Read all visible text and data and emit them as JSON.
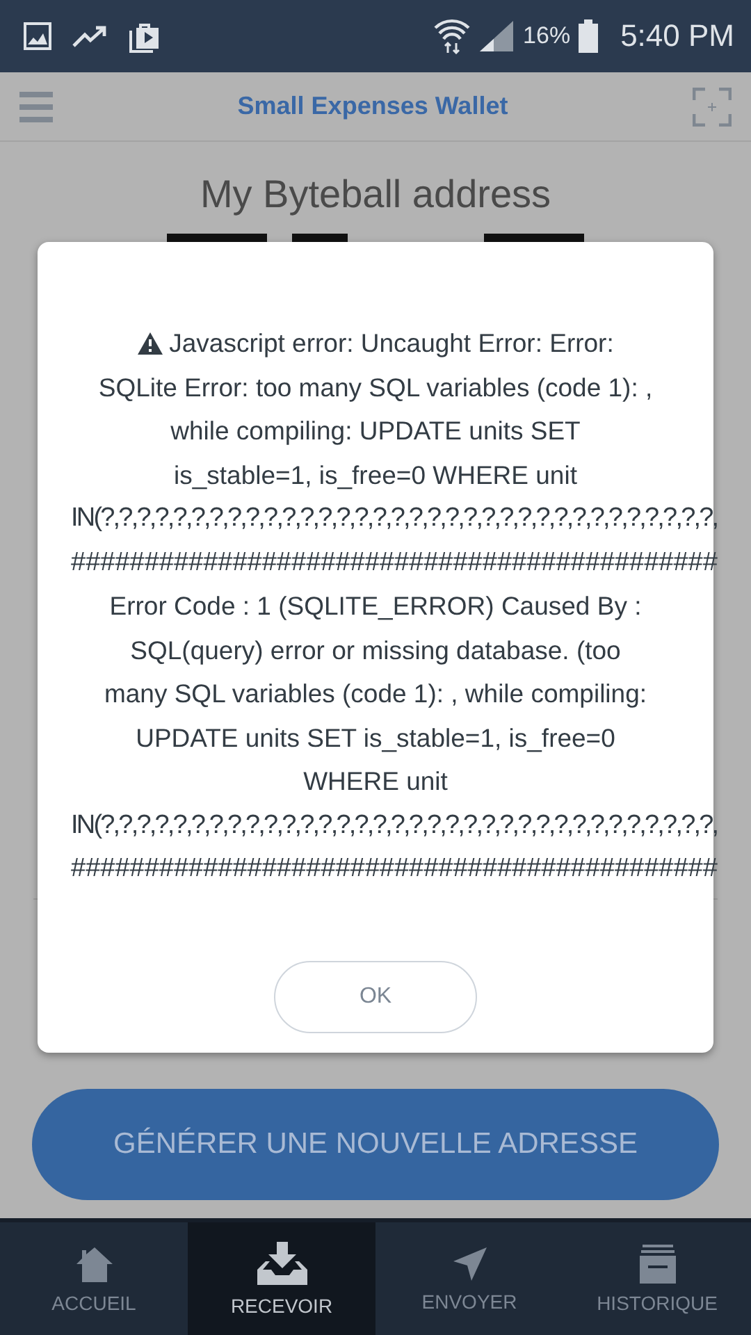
{
  "status_bar": {
    "battery": "16%",
    "time": "5:40 PM"
  },
  "header": {
    "title": "Small Expenses Wallet"
  },
  "content": {
    "heading": "My Byteball address",
    "generate_button": "GÉNÉRER UNE NOUVELLE ADRESSE"
  },
  "dialog": {
    "lines": [
      {
        "kind": "warning",
        "text": "Javascript error: Uncaught Error: Error:"
      },
      {
        "kind": "centered",
        "text": "SQLite Error: too many SQL variables (code 1): ,"
      },
      {
        "kind": "centered",
        "text": "while compiling: UPDATE units SET"
      },
      {
        "kind": "centered",
        "text": "is_stable=1, is_free=0 WHERE unit"
      },
      {
        "kind": "overflow",
        "text": "IN(?,?,?,?,?,?,?,?,?,?,?,?,?,?,?,?,?,?,?,?,?,?,?,?,?,?,?,?,?,?,?,?,?,?,"
      },
      {
        "kind": "overflow",
        "text": "############################################"
      },
      {
        "kind": "centered",
        "text": "Error Code : 1 (SQLITE_ERROR) Caused By :"
      },
      {
        "kind": "centered",
        "text": "SQL(query) error or missing database. (too"
      },
      {
        "kind": "centered",
        "text": "many SQL variables (code 1): , while compiling:"
      },
      {
        "kind": "centered",
        "text": "UPDATE units SET is_stable=1, is_free=0"
      },
      {
        "kind": "centered",
        "text": "WHERE unit"
      },
      {
        "kind": "overflow",
        "text": "IN(?,?,?,?,?,?,?,?,?,?,?,?,?,?,?,?,?,?,?,?,?,?,?,?,?,?,?,?,?,?,?,?,?,?,"
      },
      {
        "kind": "overflow",
        "text": "############################################"
      }
    ],
    "ok_button": "OK"
  },
  "bottom_nav": [
    {
      "label": "ACCUEIL",
      "selected": false
    },
    {
      "label": "RECEVOIR",
      "selected": true
    },
    {
      "label": "ENVOYER",
      "selected": false
    },
    {
      "label": "HISTORIQUE",
      "selected": false
    }
  ]
}
